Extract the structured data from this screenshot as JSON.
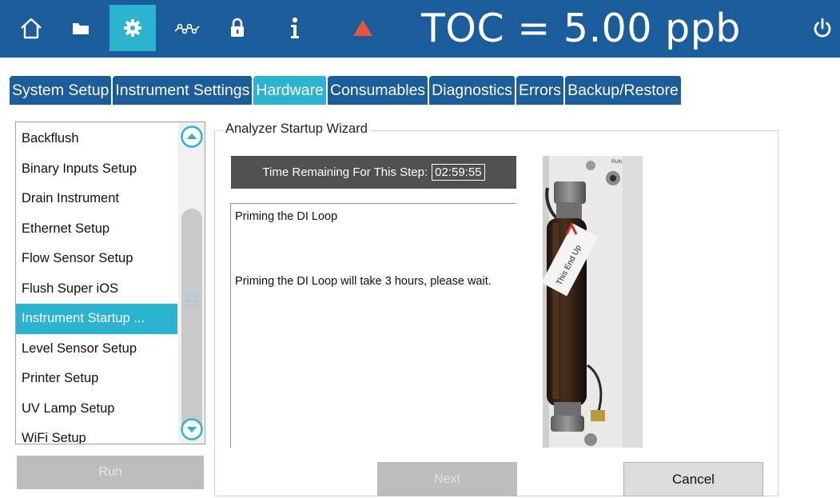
{
  "header": {
    "toolbar": [
      {
        "icon": "home-icon"
      },
      {
        "icon": "folder-icon"
      },
      {
        "icon": "gear-icon",
        "active": true
      },
      {
        "icon": "trend-icon"
      },
      {
        "icon": "lock-icon"
      },
      {
        "icon": "info-icon"
      },
      {
        "icon": "warning-icon",
        "color": "#e8553f"
      }
    ],
    "reading": "TOC = 5.00 ppb",
    "power_icon": "power-icon"
  },
  "tabs": [
    {
      "label": "System Setup"
    },
    {
      "label": "Instrument Settings"
    },
    {
      "label": "Hardware",
      "active": true
    },
    {
      "label": "Consumables"
    },
    {
      "label": "Diagnostics"
    },
    {
      "label": "Errors"
    },
    {
      "label": "Backup/Restore"
    }
  ],
  "list": {
    "items": [
      "Backflush",
      "Binary Inputs Setup",
      "Drain Instrument",
      "Ethernet Setup",
      "Flow Sensor Setup",
      "Flush Super iOS",
      "Instrument Startup ...",
      "Level Sensor Setup",
      "Printer Setup",
      "UV Lamp Setup",
      "WiFi Setup"
    ],
    "selected_index": 6,
    "run_label": "Run"
  },
  "wizard": {
    "title": "Analyzer Startup Wizard",
    "time_label": "Time Remaining For This Step:",
    "time_value": "02:59:55",
    "message_title": "Priming the DI Loop",
    "message_body": "Priming the DI Loop will take 3 hours, please wait.",
    "photo_labels": {
      "run": "RUN",
      "cartridge": "This End Up"
    },
    "next_label": "Next",
    "cancel_label": "Cancel"
  },
  "colors": {
    "header_blue": "#1a5d9a",
    "accent_cyan": "#2bb3cf",
    "alarm_red": "#e8553f"
  }
}
